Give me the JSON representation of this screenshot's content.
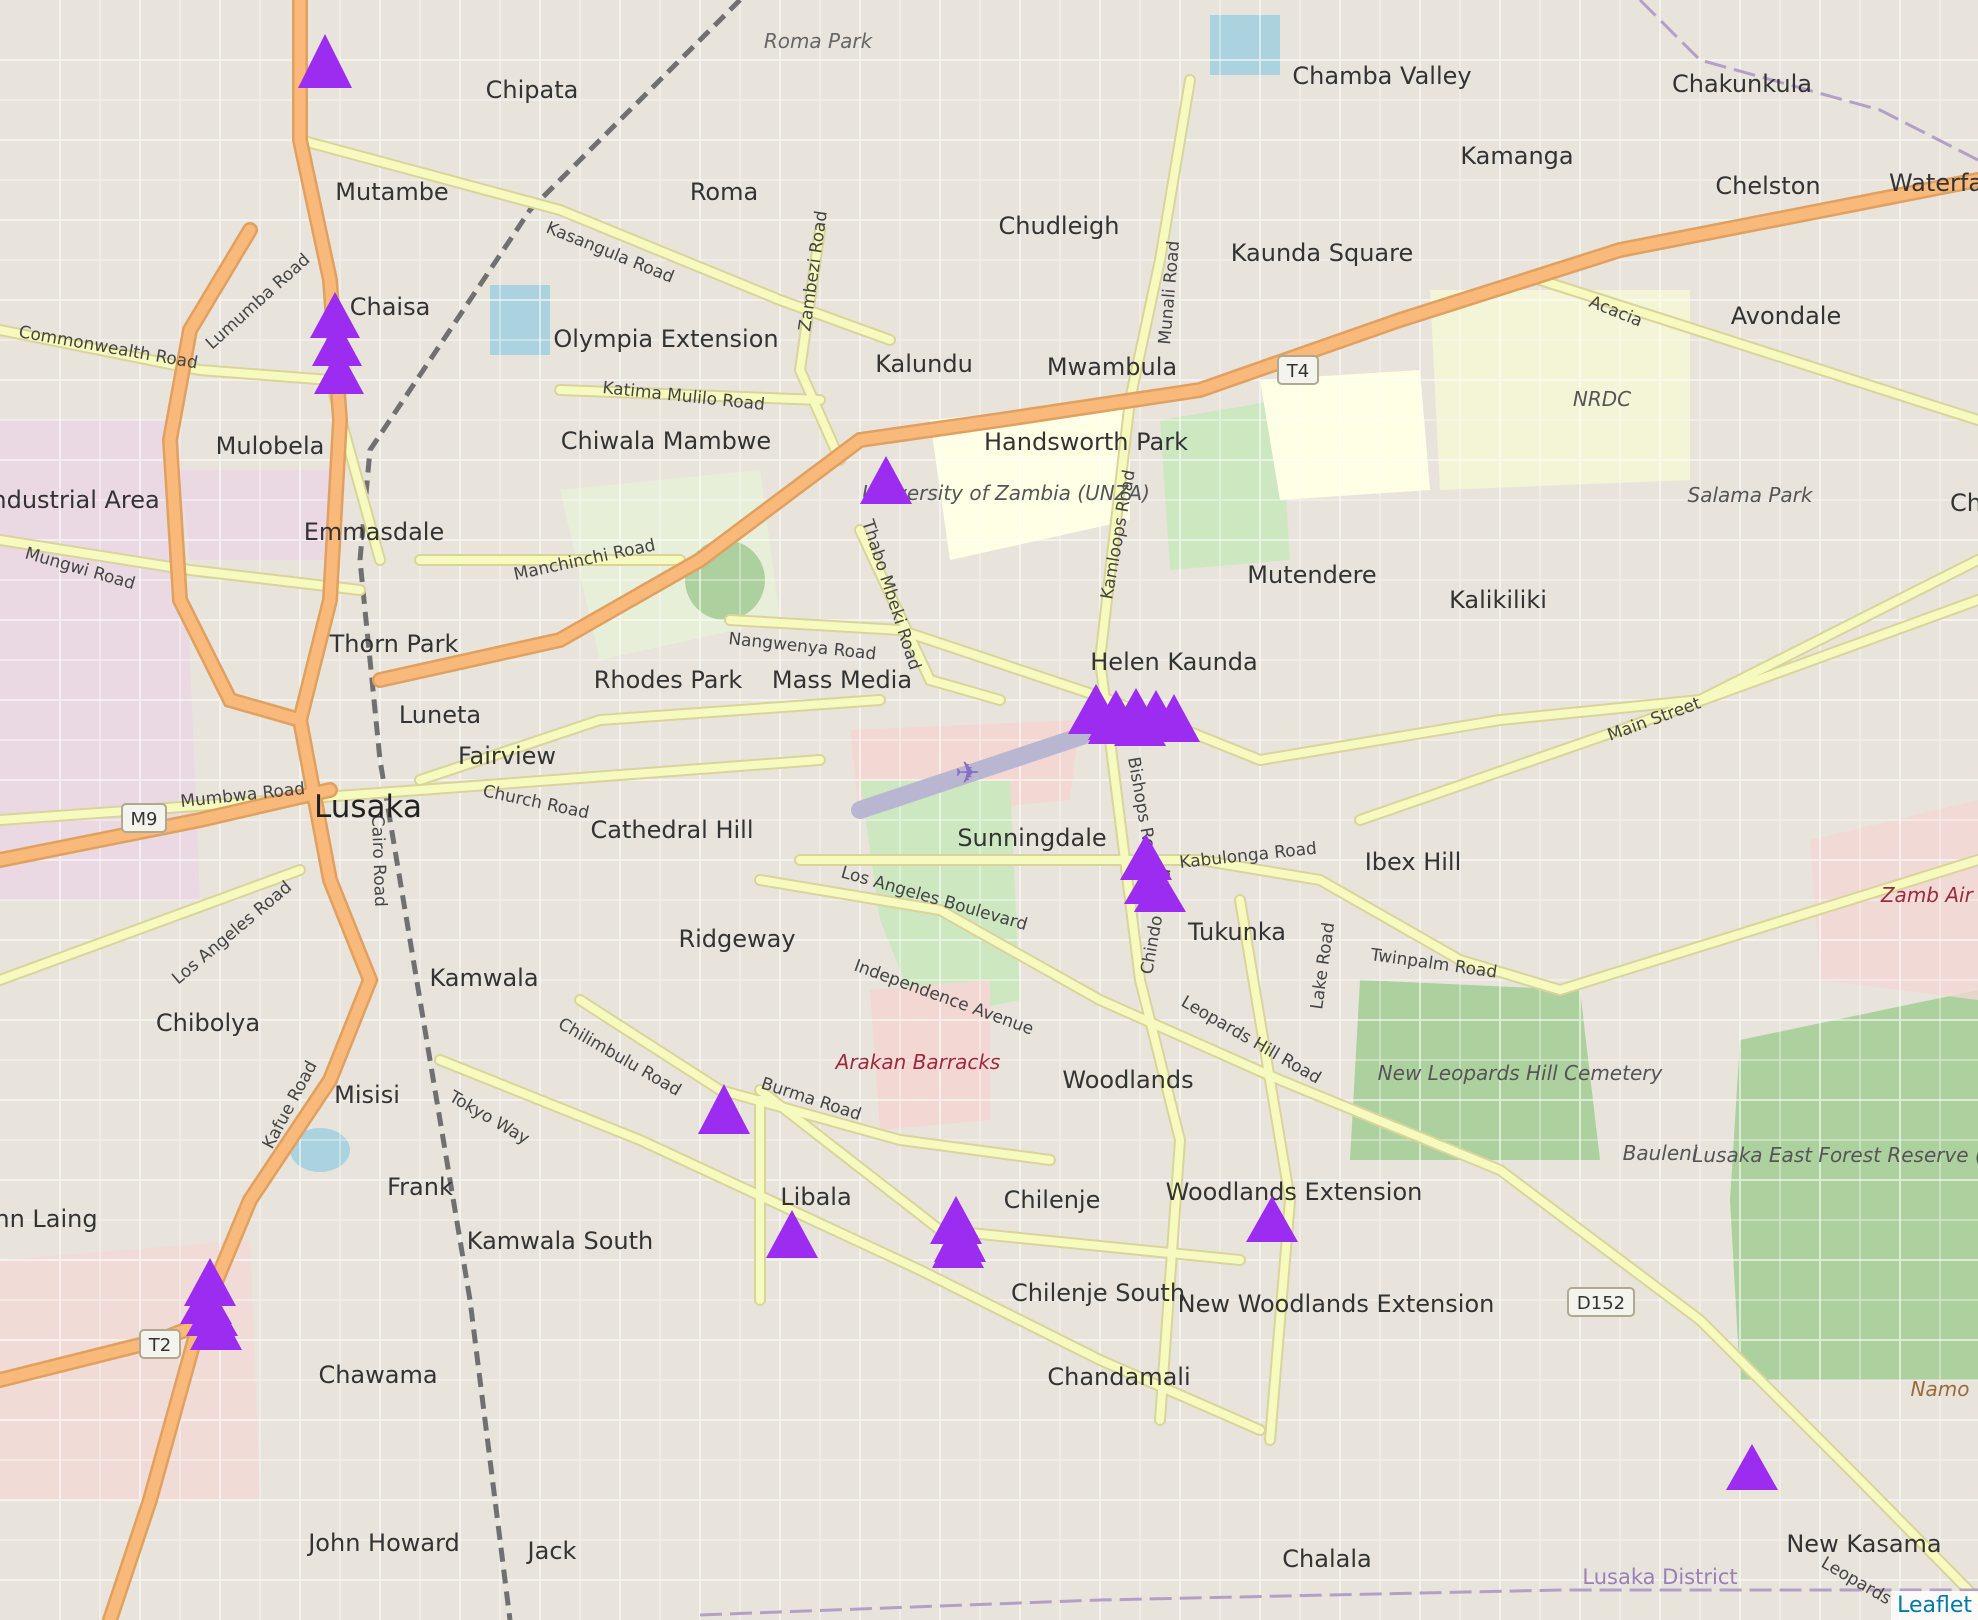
{
  "map": {
    "city_label": "Lusaka",
    "district_label": "Lusaka District",
    "neighbourhoods": [
      "Roma Park",
      "Chipata",
      "Chamba Valley",
      "Chakunkula",
      "Mutambe",
      "Roma",
      "Kamanga",
      "Chelston",
      "Chudleigh",
      "Kaunda Square",
      "Chaisa",
      "Olympia Extension",
      "Kalundu",
      "Mwambula",
      "Avondale",
      "Mulobela",
      "Chiwala Mambwe",
      "Handsworth Park",
      "Industrial Area",
      "Emmasdale",
      "Mutendere",
      "Kalikiliki",
      "Thorn Park",
      "Helen Kaunda",
      "Rhodes Park",
      "Mass Media",
      "Luneta",
      "Fairview",
      "Cathedral Hill",
      "Sunningdale",
      "Ibex Hill",
      "Ridgeway",
      "Tukunka",
      "Kamwala",
      "Chibolya",
      "Woodlands",
      "Misisi",
      "Frank",
      "Libala",
      "Chilenje",
      "Woodlands Extension",
      "hn Laing",
      "Kamwala South",
      "Chilenje South",
      "New Woodlands Extension",
      "Chawama",
      "Chandamali",
      "John Howard",
      "Jack",
      "Chalala",
      "New Kasama",
      "Waterfa",
      "Ch"
    ],
    "areas": [
      "University of Zambia (UNZA)",
      "NRDC",
      "Salama Park",
      "Arakan Barracks",
      "New Leopards Hill Cemetery",
      "Bauleni",
      "Lusaka East Forest Reserve (approxim",
      "Zamb Air For",
      "Namo"
    ],
    "roads": [
      "Kasangula Road",
      "Lumumba Road",
      "Commonwealth Road",
      "Zambezi Road",
      "Munali Road",
      "Katima Mulilo Road",
      "Acacia",
      "Mungwi Road",
      "Manchinchi Road",
      "Thabo Mbeki Road",
      "Kamloops Road",
      "Nangwenya Road",
      "Main Street",
      "Church Road",
      "Mumbwa Road",
      "Cairo Road",
      "Bishops Road",
      "Kabulonga Road",
      "Los Angeles Road",
      "Los Angeles Boulevard",
      "Independence Avenue",
      "Lake Road",
      "Twinpalm Road",
      "Chindo Road",
      "Leopards Hill Road",
      "Chilimbulu Road",
      "Burma Road",
      "Tokyo Way",
      "Kafue Road",
      "Leopards"
    ],
    "route_shields": [
      "T4",
      "M9",
      "T2",
      "D152"
    ],
    "marker_count": 26,
    "colors": {
      "marker": "#9b2cf0",
      "road_major": "#f9b97a",
      "road_secondary": "#f7fabf",
      "land": "#f2efe9",
      "university": "#ffffe5",
      "forest": "#add19e",
      "military": "#f3d7d3",
      "water": "#aad3df"
    }
  },
  "attribution": {
    "link_label": "Leaflet"
  }
}
